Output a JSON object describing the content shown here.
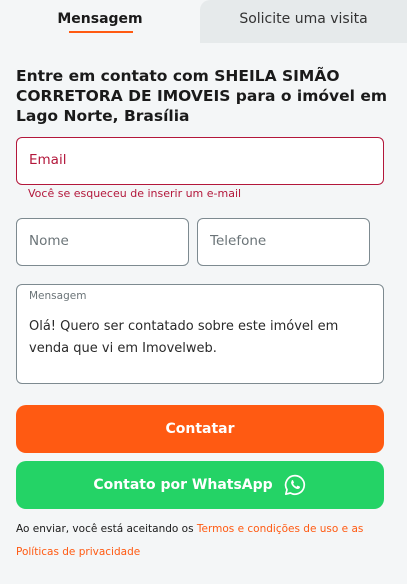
{
  "tabs": [
    {
      "label": "Mensagem",
      "active": true
    },
    {
      "label": "Solicite uma visita",
      "active": false
    }
  ],
  "heading": "Entre em contato com SHEILA SIMÃO CORRETORA DE IMOVEIS para o imóvel em Lago Norte, Brasília",
  "form": {
    "email_placeholder": "Email",
    "email_error": "Você se esqueceu de inserir um e-mail",
    "nome_placeholder": "Nome",
    "telefone_placeholder": "Telefone",
    "mensagem_label": "Mensagem",
    "mensagem_value": "Olá! Quero ser contatado sobre este imóvel em venda que vi em Imovelweb."
  },
  "buttons": {
    "contatar": "Contatar",
    "whatsapp": "Contato por WhatsApp",
    "whatsapp_icon": "whatsapp-icon"
  },
  "legal": {
    "prefix": "Ao enviar, você está aceitando os ",
    "terms_link": "Termos e condições de uso e as Políticas de privacidade"
  },
  "colors": {
    "accent": "#ff5a12",
    "whatsapp": "#24d366",
    "error": "#b3173b"
  }
}
